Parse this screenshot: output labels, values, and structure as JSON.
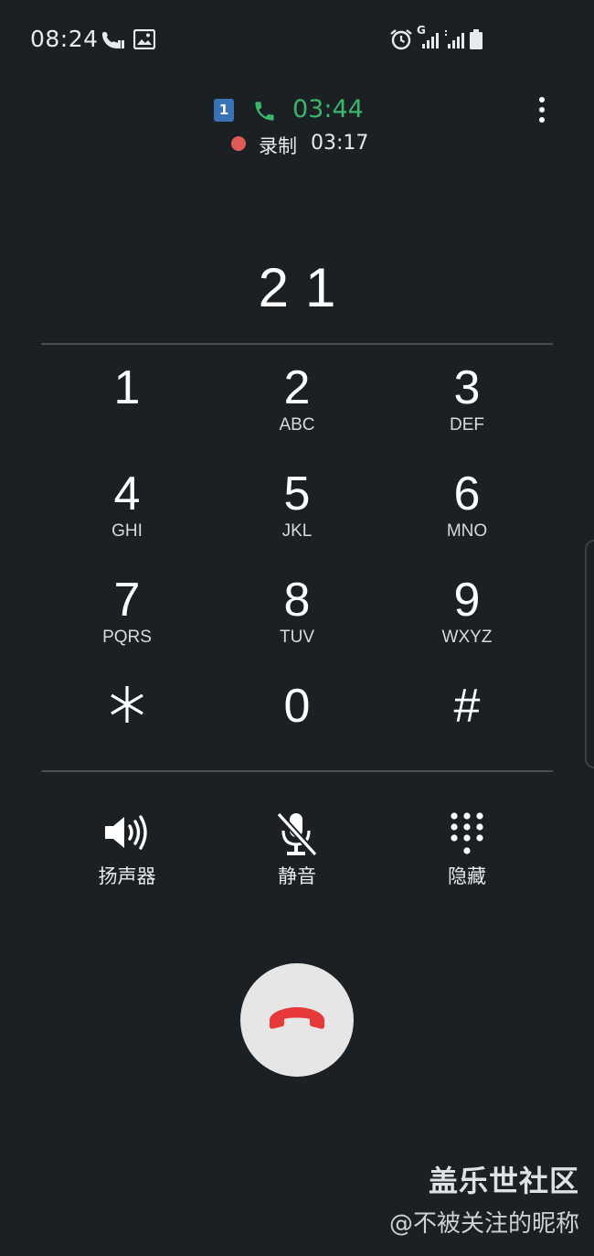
{
  "status_bar": {
    "time": "08:24",
    "icons": [
      "call-in-progress-icon",
      "gallery-icon",
      "alarm-icon",
      "signal-g-icon",
      "signal-icon",
      "battery-icon"
    ],
    "signal_label": "G"
  },
  "call": {
    "sim_slot": "1",
    "duration": "03:44",
    "recording_label": "录制",
    "recording_time": "03:17",
    "duration_color": "#39b66a",
    "recording_color": "#e05a56"
  },
  "dialed_number": "21",
  "keypad": [
    {
      "digit": "1",
      "letters": ""
    },
    {
      "digit": "2",
      "letters": "ABC"
    },
    {
      "digit": "3",
      "letters": "DEF"
    },
    {
      "digit": "4",
      "letters": "GHI"
    },
    {
      "digit": "5",
      "letters": "JKL"
    },
    {
      "digit": "6",
      "letters": "MNO"
    },
    {
      "digit": "7",
      "letters": "PQRS"
    },
    {
      "digit": "8",
      "letters": "TUV"
    },
    {
      "digit": "9",
      "letters": "WXYZ"
    },
    {
      "digit": "*",
      "letters": ""
    },
    {
      "digit": "0",
      "letters": ""
    },
    {
      "digit": "#",
      "letters": ""
    }
  ],
  "controls": {
    "speaker": "扬声器",
    "mute": "静音",
    "hide": "隐藏"
  },
  "end_call_color": "#e8393a",
  "watermark": {
    "title": "盖乐世社区",
    "user": "@不被关注的昵称"
  }
}
